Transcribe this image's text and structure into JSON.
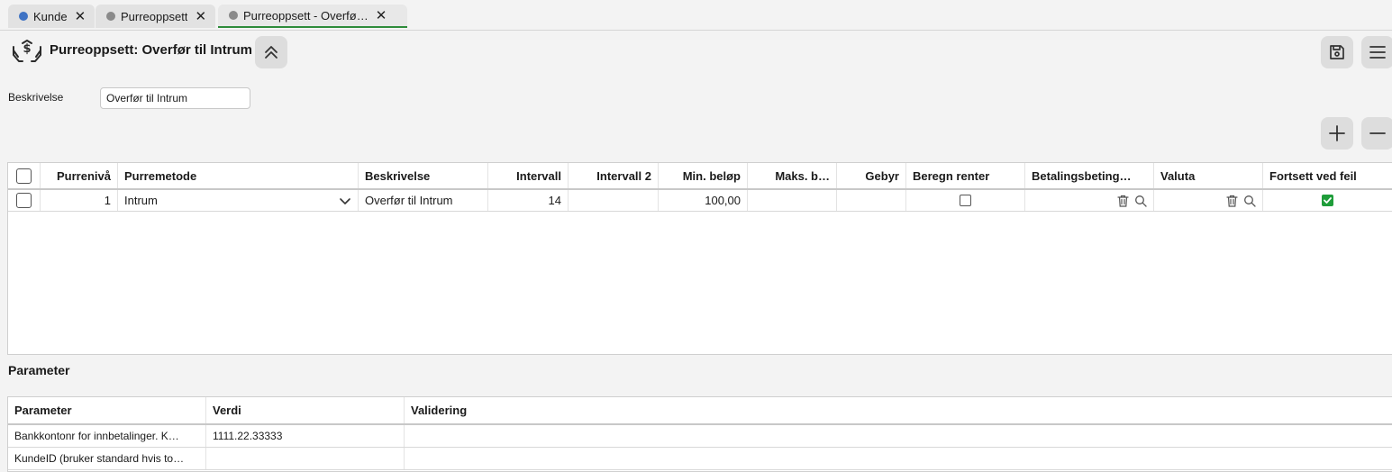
{
  "tabs": [
    {
      "label": "Kunde",
      "dot_color": "#3f73c4"
    },
    {
      "label": "Purreoppsett",
      "dot_color": "#8a8a8a"
    },
    {
      "label": "Purreoppsett - Overfø…",
      "dot_color": "#8a8a8a",
      "active": true
    }
  ],
  "header": {
    "title": "Purreoppsett: Overfør til Intrum",
    "icon": "hands-money-icon",
    "collapse_icon": "double-chevron-up-icon",
    "save_icon": "save-icon",
    "menu_icon": "hamburger-menu-icon"
  },
  "form": {
    "description_label": "Beskrivelse",
    "description_value": "Overfør til Intrum"
  },
  "grid_actions": {
    "add_icon": "plus-icon",
    "remove_icon": "minus-icon"
  },
  "grid": {
    "columns": [
      "Purrenivå",
      "Purremetode",
      "Beskrivelse",
      "Intervall",
      "Intervall 2",
      "Min. beløp",
      "Maks. b…",
      "Gebyr",
      "Beregn renter",
      "Betalingsbeting…",
      "Valuta",
      "Fortsett ved feil"
    ],
    "rows": [
      {
        "level": "1",
        "method": "Intrum",
        "description": "Overfør til Intrum",
        "interval": "14",
        "interval2": "",
        "min_amount": "100,00",
        "max_amount": "",
        "fee": "",
        "calc_interest": false,
        "payment_terms": "",
        "currency": "",
        "continue_on_error": true
      }
    ]
  },
  "parameter_section": {
    "title": "Parameter",
    "columns": [
      "Parameter",
      "Verdi",
      "Validering"
    ],
    "rows": [
      {
        "parameter": "Bankkontonr for innbetalinger. K…",
        "value": "1111.22.33333",
        "validation": ""
      },
      {
        "parameter": "KundeID (bruker standard hvis to…",
        "value": "",
        "validation": ""
      }
    ]
  },
  "colors": {
    "accent_green": "#1f9d3a",
    "tab_active_border": "#2e8b3a"
  }
}
